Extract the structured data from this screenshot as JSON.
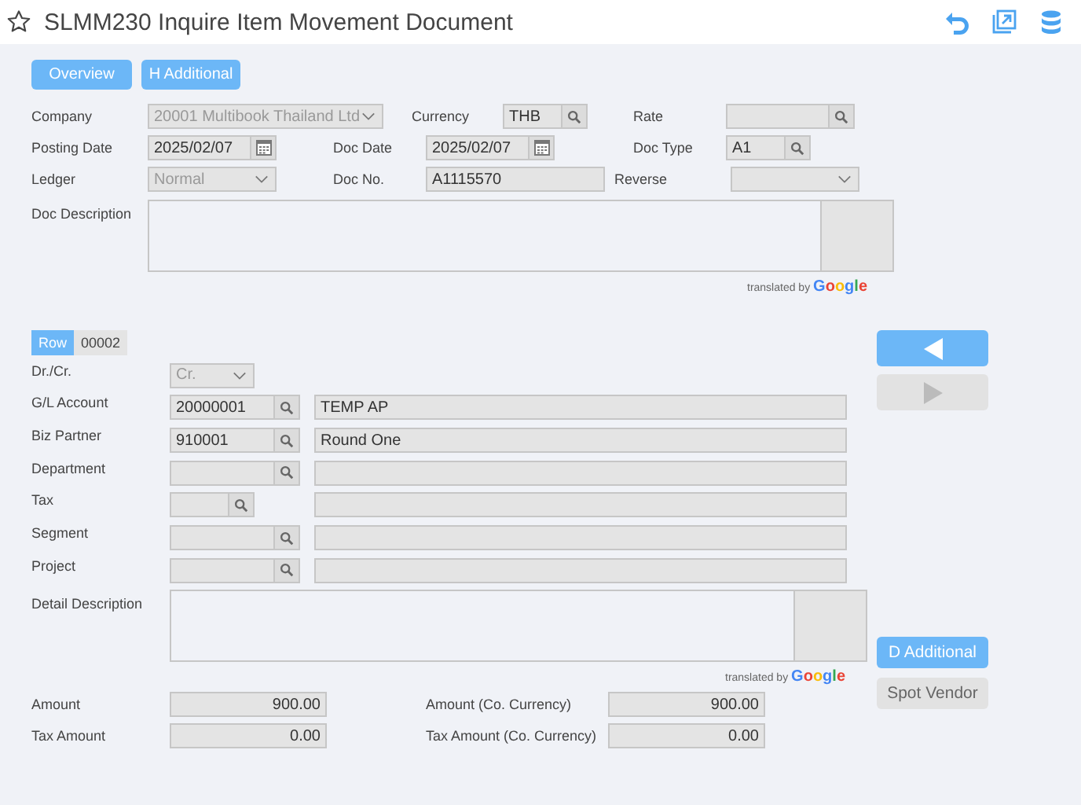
{
  "window": {
    "title": "SLMM230 Inquire Item Movement Document"
  },
  "top_buttons": [
    {
      "label": "Overview"
    },
    {
      "label": "H Additional"
    }
  ],
  "header_rows": [
    [
      {
        "label": "Company",
        "kind": "select",
        "value": "20001 Multibook Thailand Ltd",
        "disabled": true
      },
      {
        "label": "Currency",
        "kind": "lookup",
        "value": "THB"
      },
      {
        "label": "Rate",
        "kind": "lookup"
      }
    ],
    [
      {
        "label": "Posting Date",
        "kind": "date",
        "value": "2025/02/07"
      },
      {
        "label": "Doc Date",
        "kind": "date",
        "value": "2025/02/07"
      },
      {
        "label": "Doc Type",
        "kind": "lookup",
        "value": "A1"
      }
    ],
    [
      {
        "label": "Ledger",
        "kind": "select",
        "value": "Normal",
        "disabled": true
      },
      {
        "label": "Doc No.",
        "kind": "text",
        "value": "A1115570"
      },
      {
        "label": "Reverse",
        "kind": "select"
      }
    ]
  ],
  "doc_description": {
    "label": "Doc Description",
    "attribution": "translated by",
    "brand": "Google"
  },
  "row": {
    "label": "Row",
    "value": "00002"
  },
  "row_nav": [
    {
      "kind": "previous",
      "disabled": false
    },
    {
      "kind": "next",
      "disabled": true
    }
  ],
  "detail_fields": [
    {
      "label": "Dr./Cr.",
      "kind": "select",
      "value": "Cr.",
      "disabled": true
    },
    {
      "label": "G/L Account",
      "kind": "lookup",
      "value": "20000001",
      "description": "TEMP AP"
    },
    {
      "label": "Biz Partner",
      "kind": "lookup",
      "value": "910001",
      "description": "Round One"
    },
    {
      "label": "Department",
      "kind": "lookup"
    },
    {
      "label": "Tax",
      "kind": "short_lookup"
    },
    {
      "label": "Segment",
      "kind": "lookup"
    },
    {
      "label": "Project",
      "kind": "lookup"
    }
  ],
  "detail_description": {
    "label": "Detail Description",
    "attribution": "translated by",
    "brand": "Google"
  },
  "side_buttons": [
    {
      "label": "D Additional",
      "primary": true
    },
    {
      "label": "Spot Vendor",
      "primary": false
    }
  ],
  "amounts": [
    [
      {
        "label": "Amount",
        "value": "900.00"
      },
      {
        "label": "Amount (Co. Currency)",
        "value": "900.00"
      }
    ],
    [
      {
        "label": "Tax Amount",
        "value": "0.00"
      },
      {
        "label": "Tax Amount (Co. Currency)",
        "value": "0.00"
      }
    ]
  ]
}
